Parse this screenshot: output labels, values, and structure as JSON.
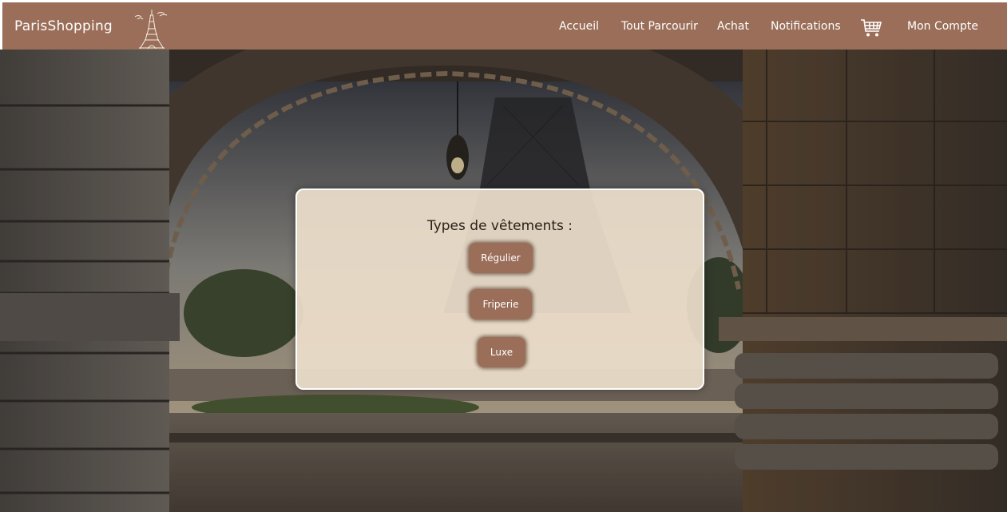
{
  "app": {
    "brand": "ParisShopping"
  },
  "nav": {
    "accueil": "Accueil",
    "tout_parcourir": "Tout Parcourir",
    "achat": "Achat",
    "notifications": "Notifications",
    "mon_compte": "Mon Compte"
  },
  "types": {
    "title": "Types de vêtements :",
    "buttons": [
      "Régulier",
      "Friperie",
      "Luxe"
    ]
  },
  "colors": {
    "navbar": "#9a6e58",
    "button": "#9a6e58",
    "card": "#ecdeca"
  },
  "icons": {
    "logo": "eiffel-tower-icon",
    "cart": "shopping-cart-icon"
  }
}
